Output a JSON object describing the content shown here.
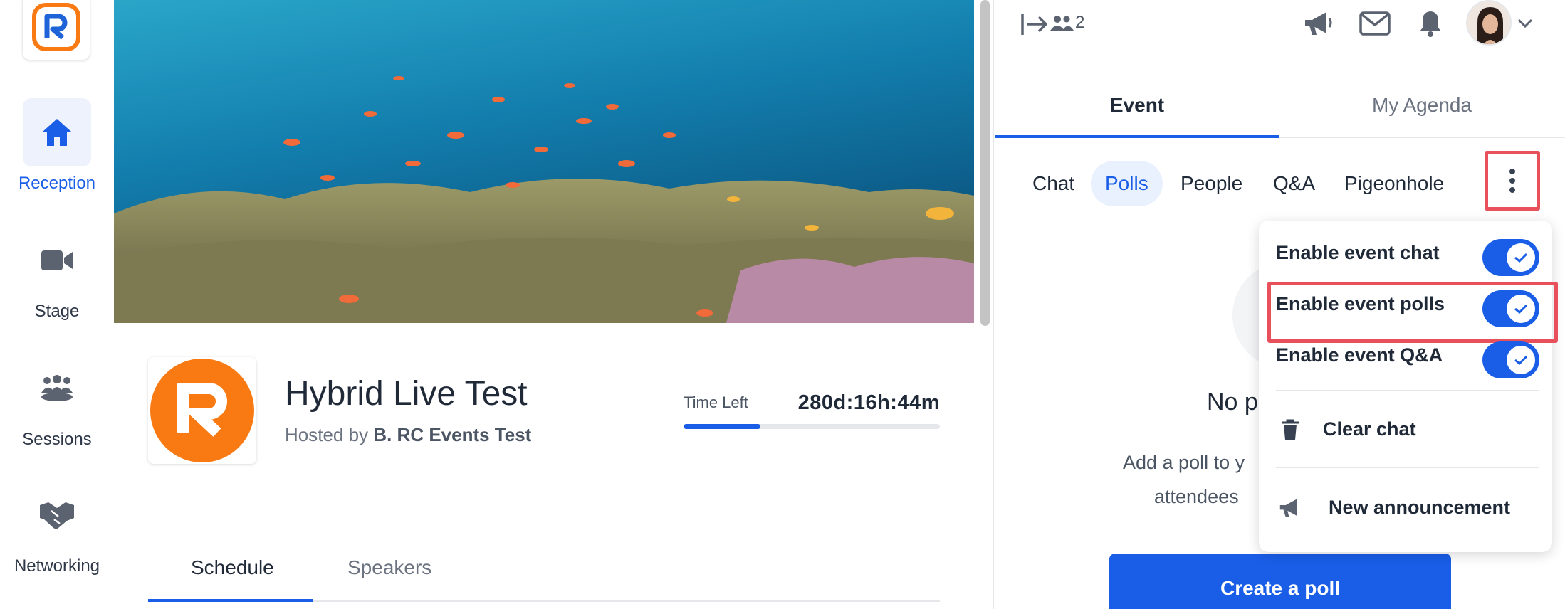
{
  "nav": {
    "items": [
      {
        "label": "Reception",
        "icon": "home-icon",
        "active": true
      },
      {
        "label": "Stage",
        "icon": "video-camera-icon",
        "active": false
      },
      {
        "label": "Sessions",
        "icon": "group-icon",
        "active": false
      },
      {
        "label": "Networking",
        "icon": "handshake-icon",
        "active": false
      }
    ]
  },
  "event": {
    "title": "Hybrid Live Test",
    "host_prefix": "Hosted by",
    "host_name": "B. RC Events Test",
    "time_left_label": "Time Left",
    "time_left_value": "280d:16h:44m",
    "time_left_progress": 0.3
  },
  "schedule_tabs": [
    "Schedule",
    "Speakers"
  ],
  "topbar": {
    "people_count": "2"
  },
  "panel": {
    "main_tabs": [
      "Event",
      "My Agenda"
    ],
    "sub_tabs": [
      "Chat",
      "Polls",
      "People",
      "Q&A",
      "Pigeonhole"
    ],
    "active_sub_tab": "Polls",
    "empty_title": "No p",
    "empty_desc_line1": "Add a poll to y",
    "empty_desc_line2": "attendees",
    "create_button": "Create a poll"
  },
  "dropdown": {
    "toggles": [
      {
        "label": "Enable event chat",
        "on": true
      },
      {
        "label": "Enable event polls",
        "on": true
      },
      {
        "label": "Enable event Q&A",
        "on": true
      }
    ],
    "actions": [
      {
        "label": "Clear chat",
        "icon": "trash-icon"
      },
      {
        "label": "New announcement",
        "icon": "megaphone-icon"
      }
    ]
  },
  "colors": {
    "accent": "#1a5ee8",
    "brand_orange": "#f97a12",
    "highlight": "#e8505b"
  }
}
